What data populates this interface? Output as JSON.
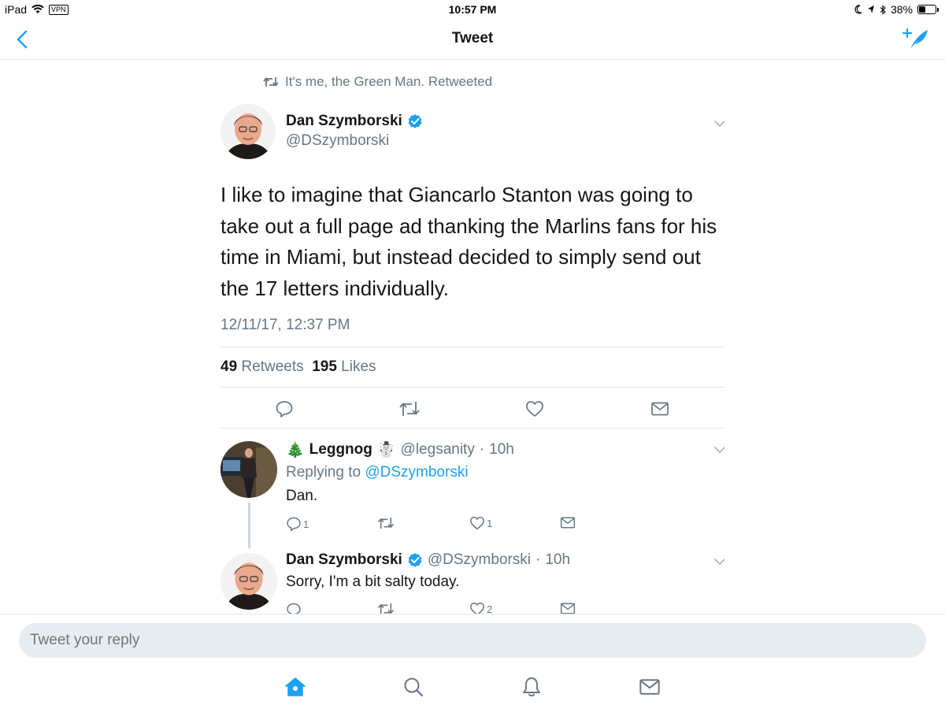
{
  "status": {
    "device": "iPad",
    "vpn": "VPN",
    "time": "10:57 PM",
    "battery": "38%",
    "battery_level": 0.38
  },
  "nav": {
    "title": "Tweet"
  },
  "colors": {
    "accent": "#1da1f2",
    "muted": "#657786",
    "text": "#14171a",
    "divider": "#e1e8ed"
  },
  "tweet": {
    "retweet_context": "It's me, the Green Man. Retweeted",
    "author_name": "Dan Szymborski",
    "author_handle": "@DSzymborski",
    "text_lines": [
      "I like to imagine that Giancarlo Stanton was going to",
      "take out a full page ad thanking the Marlins fans for his",
      "time in Miami, but instead decided to simply send out",
      "the 17 letters individually."
    ],
    "timestamp": "12/11/17, 12:37 PM",
    "retweet_count": "49",
    "retweet_label": "Retweets",
    "like_count": "195",
    "like_label": "Likes"
  },
  "replies": [
    {
      "name_prefix_emoji": "🎄",
      "name": "Leggnog",
      "name_suffix_emoji": "☃️",
      "handle": "@legsanity",
      "time": "10h",
      "replying_to_label": "Replying to",
      "replying_to_handle": "@DSzymborski",
      "text": "Dan.",
      "reply_count": "1",
      "like_count": "1"
    },
    {
      "name": "Dan Szymborski",
      "handle": "@DSzymborski",
      "time": "10h",
      "text": "Sorry, I'm a bit salty today.",
      "like_count": "2"
    }
  ],
  "reply_box": {
    "placeholder": "Tweet your reply"
  },
  "tabbar": [
    "home-icon",
    "search-icon",
    "notifications-icon",
    "messages-icon"
  ]
}
